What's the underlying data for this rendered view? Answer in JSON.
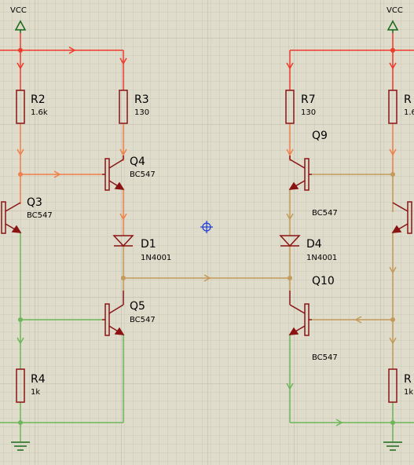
{
  "colors": {
    "background": "#dfdccb",
    "grid": "#c9c8b8",
    "component": "#8a1414",
    "wire_red": "#ef3b2c",
    "wire_orange": "#f0804a",
    "wire_tan": "#c49a5a",
    "wire_green": "#6eb65a",
    "vcc": "#1a6a1a",
    "marker": "#1c3cd8"
  },
  "power": {
    "vcc_left": "VCC",
    "vcc_right": "VCC"
  },
  "components": {
    "r2": {
      "name": "R2",
      "value": "1.6k"
    },
    "r3": {
      "name": "R3",
      "value": "130"
    },
    "r4": {
      "name": "R4",
      "value": "1k"
    },
    "r7": {
      "name": "R7",
      "value": "130"
    },
    "r_right_top": {
      "name": "R",
      "value": "1.6"
    },
    "r_right_bottom": {
      "name": "R",
      "value": "1k"
    },
    "q3": {
      "name": "Q3",
      "value": "BC547"
    },
    "q4": {
      "name": "Q4",
      "value": "BC547"
    },
    "q5": {
      "name": "Q5",
      "value": "BC547"
    },
    "q9": {
      "name": "Q9",
      "value": "BC547"
    },
    "q10": {
      "name": "Q10",
      "value": "BC547"
    },
    "d1": {
      "name": "D1",
      "value": "1N4001"
    },
    "d4": {
      "name": "D4",
      "value": "1N4001"
    }
  }
}
